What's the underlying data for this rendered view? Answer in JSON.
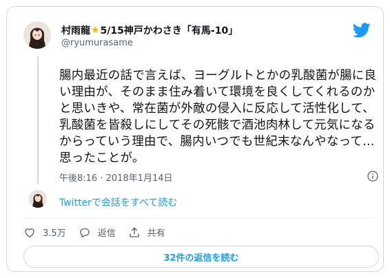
{
  "author": {
    "name_part1": "村雨龍",
    "name_part2": "5/15神戸かわさき「有馬-10」",
    "handle": "@ryumurasame"
  },
  "tweet": {
    "text": "腸内最近の話で言えば、ヨーグルトとかの乳酸菌が腸に良い理由が、そのまま住み着いて環境を良くしてくれるのかと思いきや、常在菌が外敵の侵入に反応して活性化して、乳酸菌を皆殺しにしてその死骸で酒池肉林して元気になるからっていう理由で、腸内いつでも世紀末なんやなって…思ったことが。",
    "timestamp": "午後8:16 · 2018年1月14日"
  },
  "thread": {
    "link_label": "Twitterで会話をすべて読む"
  },
  "actions": {
    "like_count": "3.5万",
    "reply_label": "返信",
    "share_label": "共有"
  },
  "replies_button": {
    "label": "32件の返信を読む"
  },
  "colors": {
    "accent": "#1d9bf0",
    "star": "#f4b400",
    "muted": "#536471"
  },
  "icons": [
    "twitter-bird-icon",
    "info-icon",
    "heart-icon",
    "reply-icon",
    "share-icon",
    "star-emoji"
  ]
}
